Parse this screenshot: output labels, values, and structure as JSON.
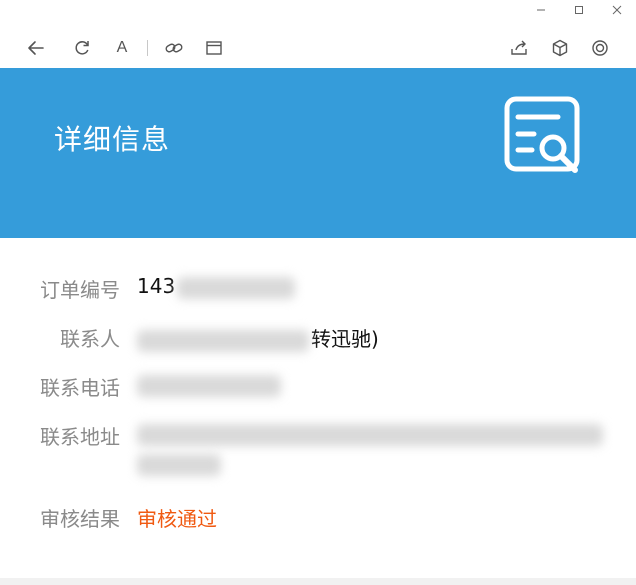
{
  "window": {
    "controls": [
      "minimize-icon",
      "maximize-icon",
      "close-icon"
    ]
  },
  "toolbar": {
    "left_icons": [
      "back-arrow-icon",
      "refresh-icon",
      "font-icon",
      "link-icon",
      "window-icon"
    ],
    "right_icons": [
      "share-icon",
      "cube-icon",
      "settings-icon"
    ],
    "font_glyph": "A"
  },
  "header": {
    "title": "详细信息",
    "background_color": "#359cda",
    "icon": "search-document-icon"
  },
  "details": {
    "order_number": {
      "label": "订单编号",
      "value_visible": "143"
    },
    "contact": {
      "label": "联系人",
      "value_visible": "转迅驰)"
    },
    "phone": {
      "label": "联系电话",
      "value_visible": ""
    },
    "address": {
      "label": "联系地址",
      "value_visible": ""
    },
    "audit_result": {
      "label": "审核结果",
      "value": "审核通过",
      "color": "#f05a12"
    }
  }
}
